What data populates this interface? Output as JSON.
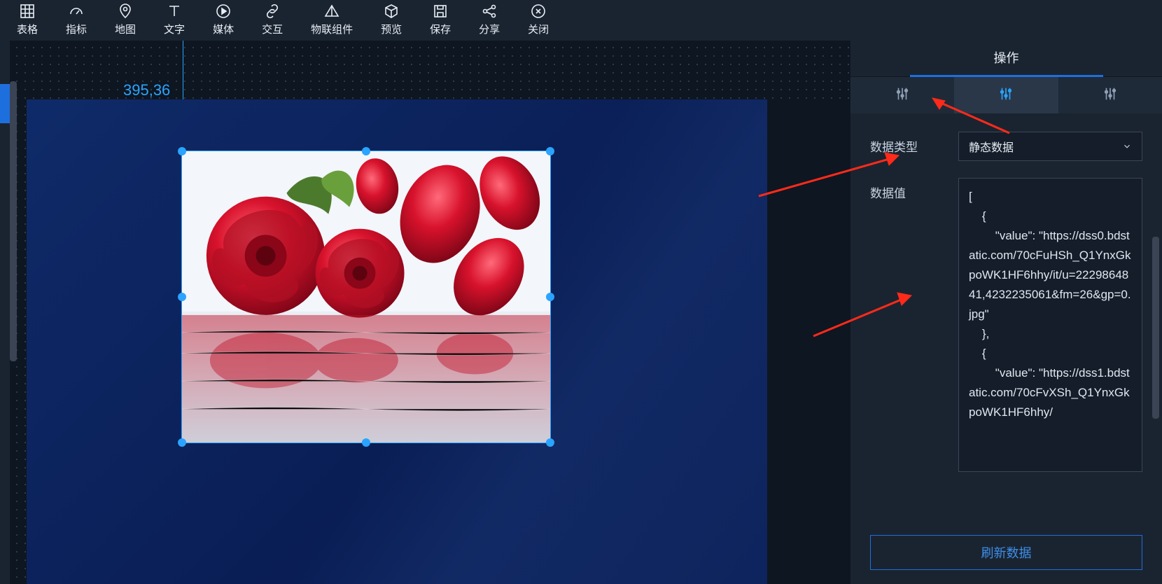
{
  "toolbar": [
    {
      "id": "table",
      "label": "表格"
    },
    {
      "id": "indicator",
      "label": "指标"
    },
    {
      "id": "map",
      "label": "地图"
    },
    {
      "id": "text",
      "label": "文字"
    },
    {
      "id": "media",
      "label": "媒体"
    },
    {
      "id": "interact",
      "label": "交互"
    },
    {
      "id": "iot",
      "label": "物联组件"
    },
    {
      "id": "preview",
      "label": "预览"
    },
    {
      "id": "save",
      "label": "保存"
    },
    {
      "id": "share",
      "label": "分享"
    },
    {
      "id": "close",
      "label": "关闭"
    }
  ],
  "canvas": {
    "selection_coord": "395,36"
  },
  "panel": {
    "tab": "操作",
    "dataTypeLabel": "数据类型",
    "dataTypeValue": "静态数据",
    "dataValueLabel": "数据值",
    "dataValueCode": "[\n    {\n        \"value\": \"https://dss0.bdstatic.com/70cFuHSh_Q1YnxGkpoWK1HF6hhy/it/u=2229864841,4232235061&fm=26&gp=0.jpg\"\n    },\n    {\n        \"value\": \"https://dss1.bdstatic.com/70cFvXSh_Q1YnxGkpoWK1HF6hhy/",
    "refresh": "刷新数据"
  }
}
